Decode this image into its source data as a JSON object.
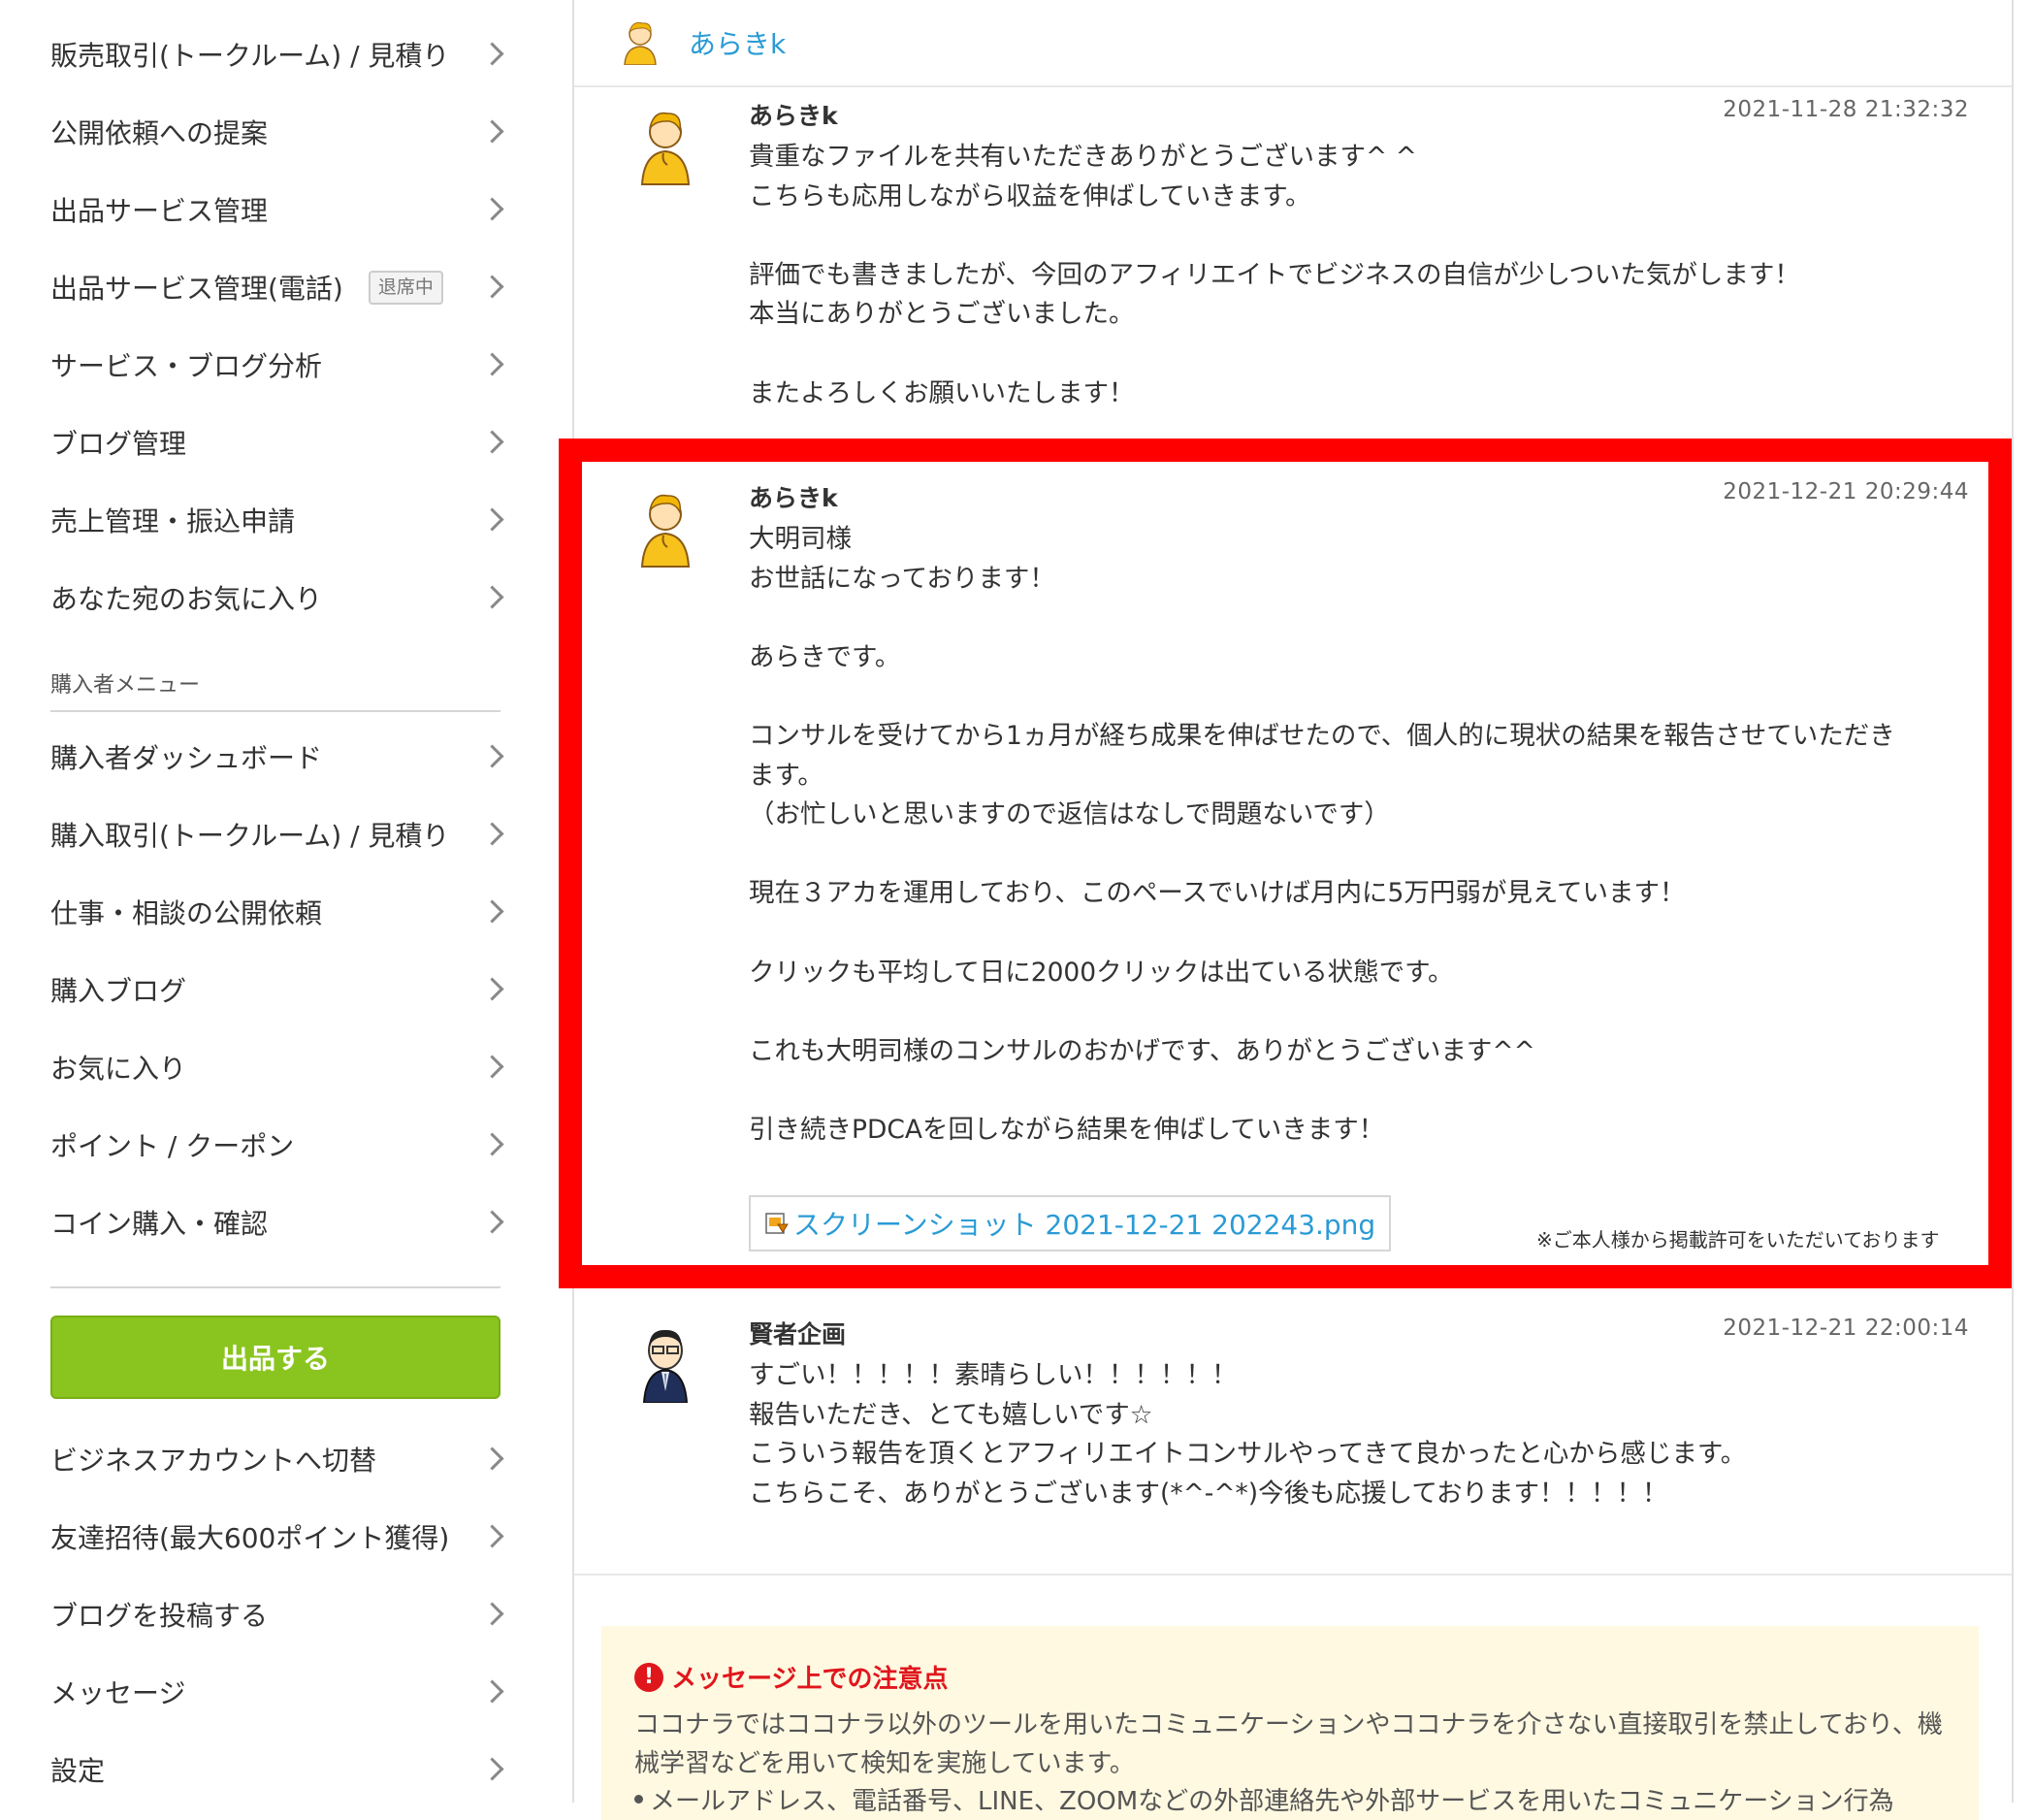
{
  "sidebar": {
    "seller_items": [
      {
        "label": "販売取引(トークルーム) / 見積り"
      },
      {
        "label": "公開依頼への提案"
      },
      {
        "label": "出品サービス管理"
      },
      {
        "label": "出品サービス管理(電話)",
        "badge": "退席中"
      },
      {
        "label": "サービス・ブログ分析"
      },
      {
        "label": "ブログ管理"
      },
      {
        "label": "売上管理・振込申請"
      },
      {
        "label": "あなた宛のお気に入り"
      }
    ],
    "buyer_section_title": "購入者メニュー",
    "buyer_items": [
      {
        "label": "購入者ダッシュボード"
      },
      {
        "label": "購入取引(トークルーム) / 見積り"
      },
      {
        "label": "仕事・相談の公開依頼"
      },
      {
        "label": "購入ブログ"
      },
      {
        "label": "お気に入り"
      },
      {
        "label": "ポイント / クーポン"
      },
      {
        "label": "コイン購入・確認"
      }
    ],
    "sell_button": "出品する",
    "other_items": [
      {
        "label": "ビジネスアカウントへ切替"
      },
      {
        "label": "友達招待(最大600ポイント獲得)"
      },
      {
        "label": "ブログを投稿する"
      },
      {
        "label": "メッセージ"
      },
      {
        "label": "設定"
      }
    ]
  },
  "header": {
    "partner_name": "あらきk"
  },
  "messages": [
    {
      "sender": "あらきk",
      "timestamp": "2021-11-28 21:32:32",
      "lines": [
        "貴重なファイルを共有いただきありがとうございます^ ^",
        "こちらも応用しながら収益を伸ばしていきます。",
        "",
        "評価でも書きましたが、今回のアフィリエイトでビジネスの自信が少しついた気がします！",
        "本当にありがとうございました。",
        "",
        "またよろしくお願いいたします！"
      ]
    },
    {
      "sender": "あらきk",
      "timestamp": "2021-12-21 20:29:44",
      "lines": [
        "大明司様",
        "お世話になっております！",
        "",
        "あらきです。",
        "",
        "コンサルを受けてから1ヵ月が経ち成果を伸ばせたので、個人的に現状の結果を報告させていただき",
        "ます。",
        "（お忙しいと思いますので返信はなしで問題ないです）",
        "",
        "現在３アカを運用しており、このペースでいけば月内に5万円弱が見えています！",
        "",
        "クリックも平均して日に2000クリックは出ている状態です。",
        "",
        "これも大明司様のコンサルのおかげです、ありがとうございます^^",
        "",
        "引き続きPDCAを回しながら結果を伸ばしていきます！"
      ],
      "attachment": "スクリーンショット 2021-12-21 202243.png",
      "permission_note": "※ご本人様から掲載許可をいただいております"
    },
    {
      "sender": "賢者企画",
      "timestamp": "2021-12-21 22:00:14",
      "lines": [
        "すごい！！！！！素晴らしい！！！！！！",
        "報告いただき、とても嬉しいです☆",
        "こういう報告を頂くとアフィリエイトコンサルやってきて良かったと心から感じます。",
        "こちらこそ、ありがとうございます(*^-^*)今後も応援しております！！！！！"
      ]
    }
  ],
  "notice": {
    "title": "メッセージ上での注意点",
    "icon": "exclamation-icon",
    "body": "ココナラではココナラ以外のツールを用いたコミュニケーションやココナラを介さない直接取引を禁止しており、機械学習などを用いて検知を実施しています。",
    "bullet": "メールアドレス、電話番号、LINE、ZOOMなどの外部連絡先や外部サービスを用いたコミュニケーション行為"
  },
  "colors": {
    "accent_link": "#2a9bd5",
    "sell_button": "#8ac51f",
    "highlight_border": "#ff0000",
    "notice_bg": "#fff9e1",
    "notice_title": "#e0161d"
  }
}
